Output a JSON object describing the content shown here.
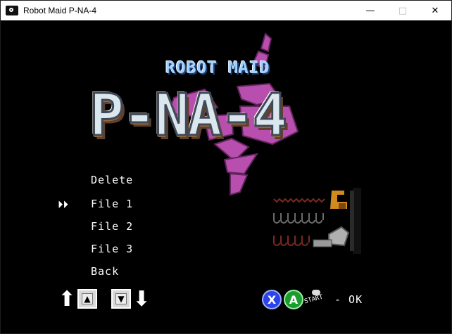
{
  "window": {
    "title": "Robot Maid P-NA-4",
    "minimize": "—",
    "maximize": "□",
    "close": "✕"
  },
  "logo": {
    "subtitle": "ROBOT MAID",
    "title": "P-NA-4"
  },
  "menu": {
    "items": [
      "Delete",
      "File 1",
      "File 2",
      "File 3",
      "Back"
    ],
    "selected_index": 1
  },
  "controls": {
    "up_icon": "up-arrow-icon",
    "down_icon": "down-arrow-icon",
    "button_x": "X",
    "button_a": "A",
    "start_label": "START",
    "ok_label": "- OK"
  },
  "colors": {
    "background": "#000000",
    "logo_purple": "#b84fae",
    "button_x": "#2b43e8",
    "button_a": "#1b9d2d"
  }
}
